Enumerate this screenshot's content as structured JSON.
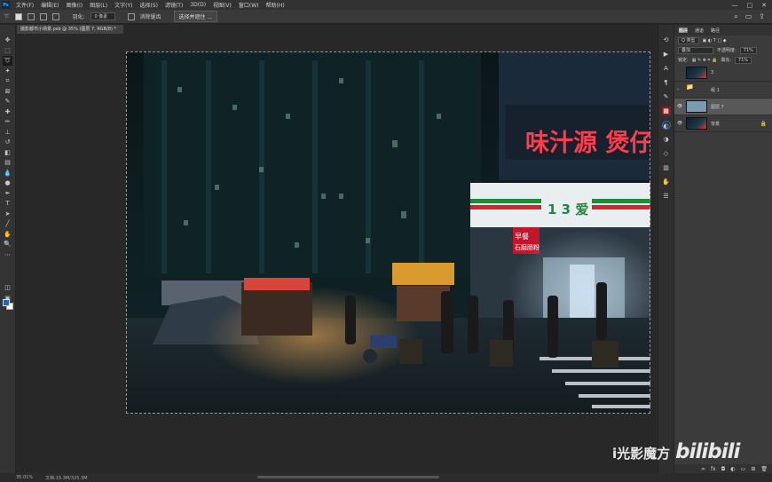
{
  "app": {
    "logo": "Ps"
  },
  "menu": [
    "文件(F)",
    "编辑(E)",
    "图像(I)",
    "图层(L)",
    "文字(Y)",
    "选择(S)",
    "滤镜(T)",
    "3D(D)",
    "视图(V)",
    "窗口(W)",
    "帮助(H)"
  ],
  "window_controls": [
    "—",
    "□",
    "✕"
  ],
  "options": {
    "feather_label": "羽化:",
    "feather_value": "0 像素",
    "antialias_label": "消除锯齿",
    "select_mask_button": "选择并遮住 ..."
  },
  "document_tab": "摄影都市小场景.psb @ 35% (图层 7, RGB/8) *",
  "photo": {
    "sign_main": "味汁源 煲仔",
    "store_sign": "1 3 爱",
    "menu_board_1": "早餐",
    "menu_board_2": "石磨肠粉"
  },
  "status": {
    "zoom": "35.01%",
    "doc": "文档:15.3M/325.3M"
  },
  "layers_panel": {
    "tabs": [
      "图层",
      "通道",
      "路径"
    ],
    "filter_label": "Q 类型",
    "blend_mode": "叠加",
    "opacity_label": "不透明度:",
    "opacity_value": "71%",
    "lock_label": "锁定:",
    "fill_label": "填充:",
    "fill_value": "71%",
    "layers": [
      {
        "name": "3",
        "type": "image",
        "visible": false
      },
      {
        "name": "组 1",
        "type": "folder",
        "visible": false
      },
      {
        "name": "图层 7",
        "type": "image",
        "visible": true,
        "selected": true
      },
      {
        "name": "背景",
        "type": "image",
        "visible": true,
        "locked": true
      }
    ]
  },
  "watermark": {
    "text": "i光影魔方",
    "logo": "bilibili"
  },
  "colors": {
    "fg": "#1e63c8",
    "bg": "#ffffff",
    "accent_red": "#e8223a",
    "neon_yellow": "#f7c84a"
  }
}
